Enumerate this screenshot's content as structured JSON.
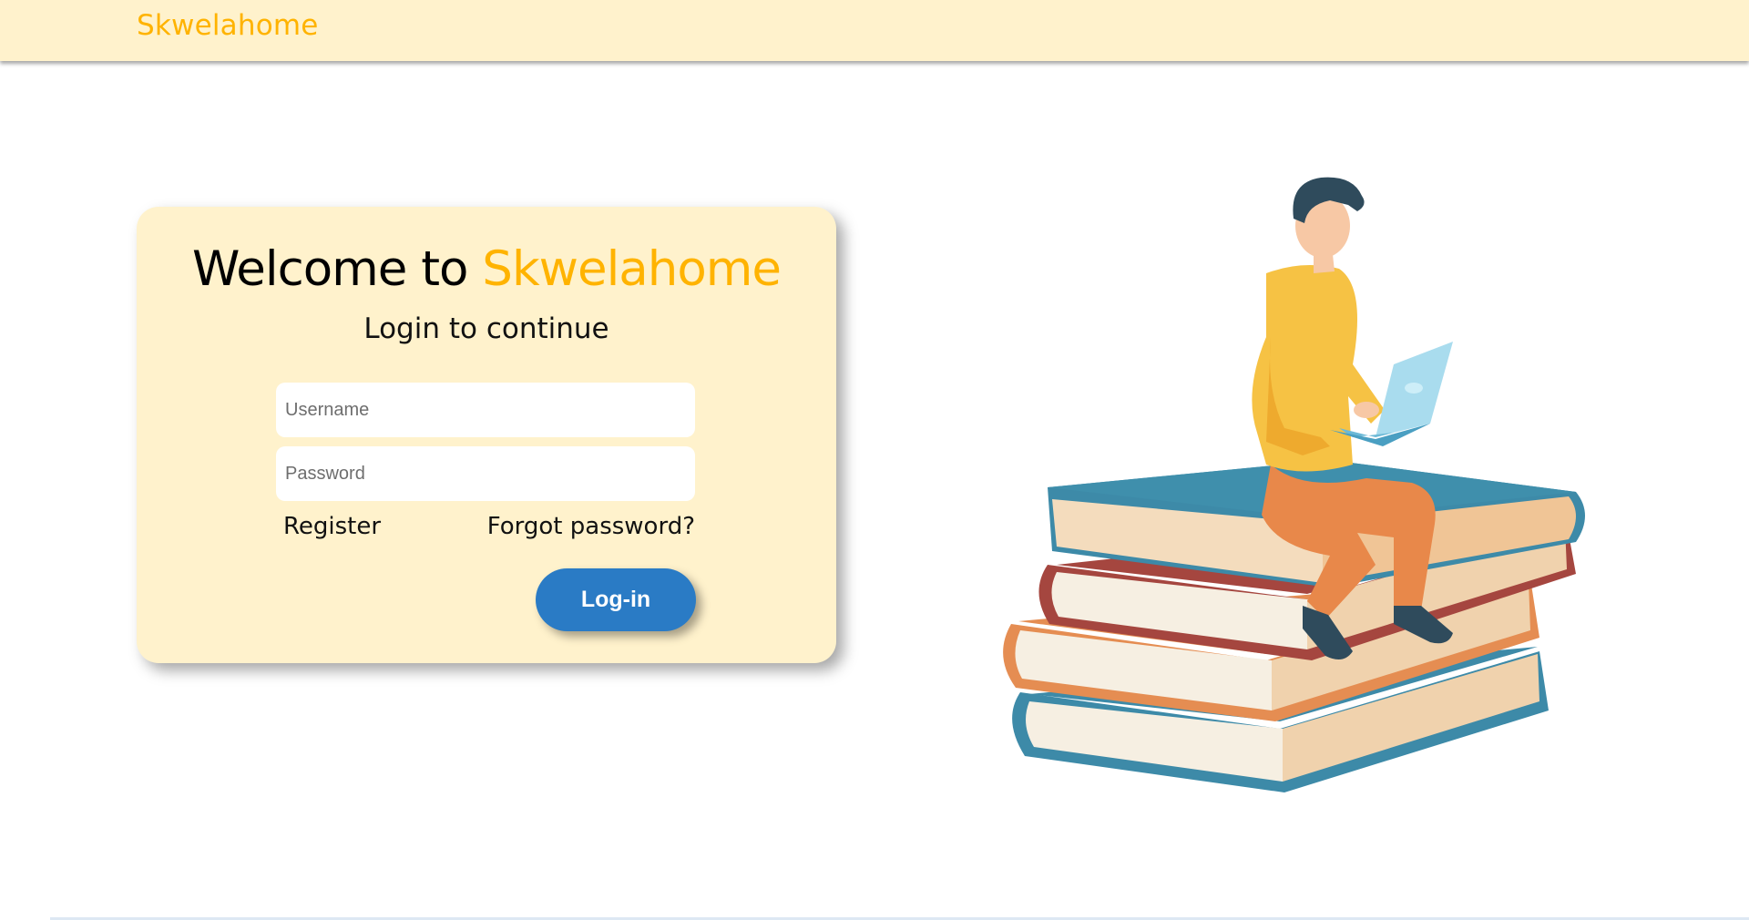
{
  "header": {
    "brand": "Skwelahome"
  },
  "login_card": {
    "welcome_prefix": "Welcome to ",
    "welcome_brand": "Skwelahome",
    "subtitle": "Login to continue",
    "username_placeholder": "Username",
    "username_value": "",
    "password_placeholder": "Password",
    "password_value": "",
    "register_label": "Register",
    "forgot_label": "Forgot password?",
    "login_label": "Log-in"
  },
  "colors": {
    "accent": "#ffb300",
    "header_bg": "#fff2cc",
    "card_bg": "#fff2cc",
    "button_bg": "#2a7bc5"
  },
  "illustration": {
    "icon": "student-on-books-illustration"
  }
}
